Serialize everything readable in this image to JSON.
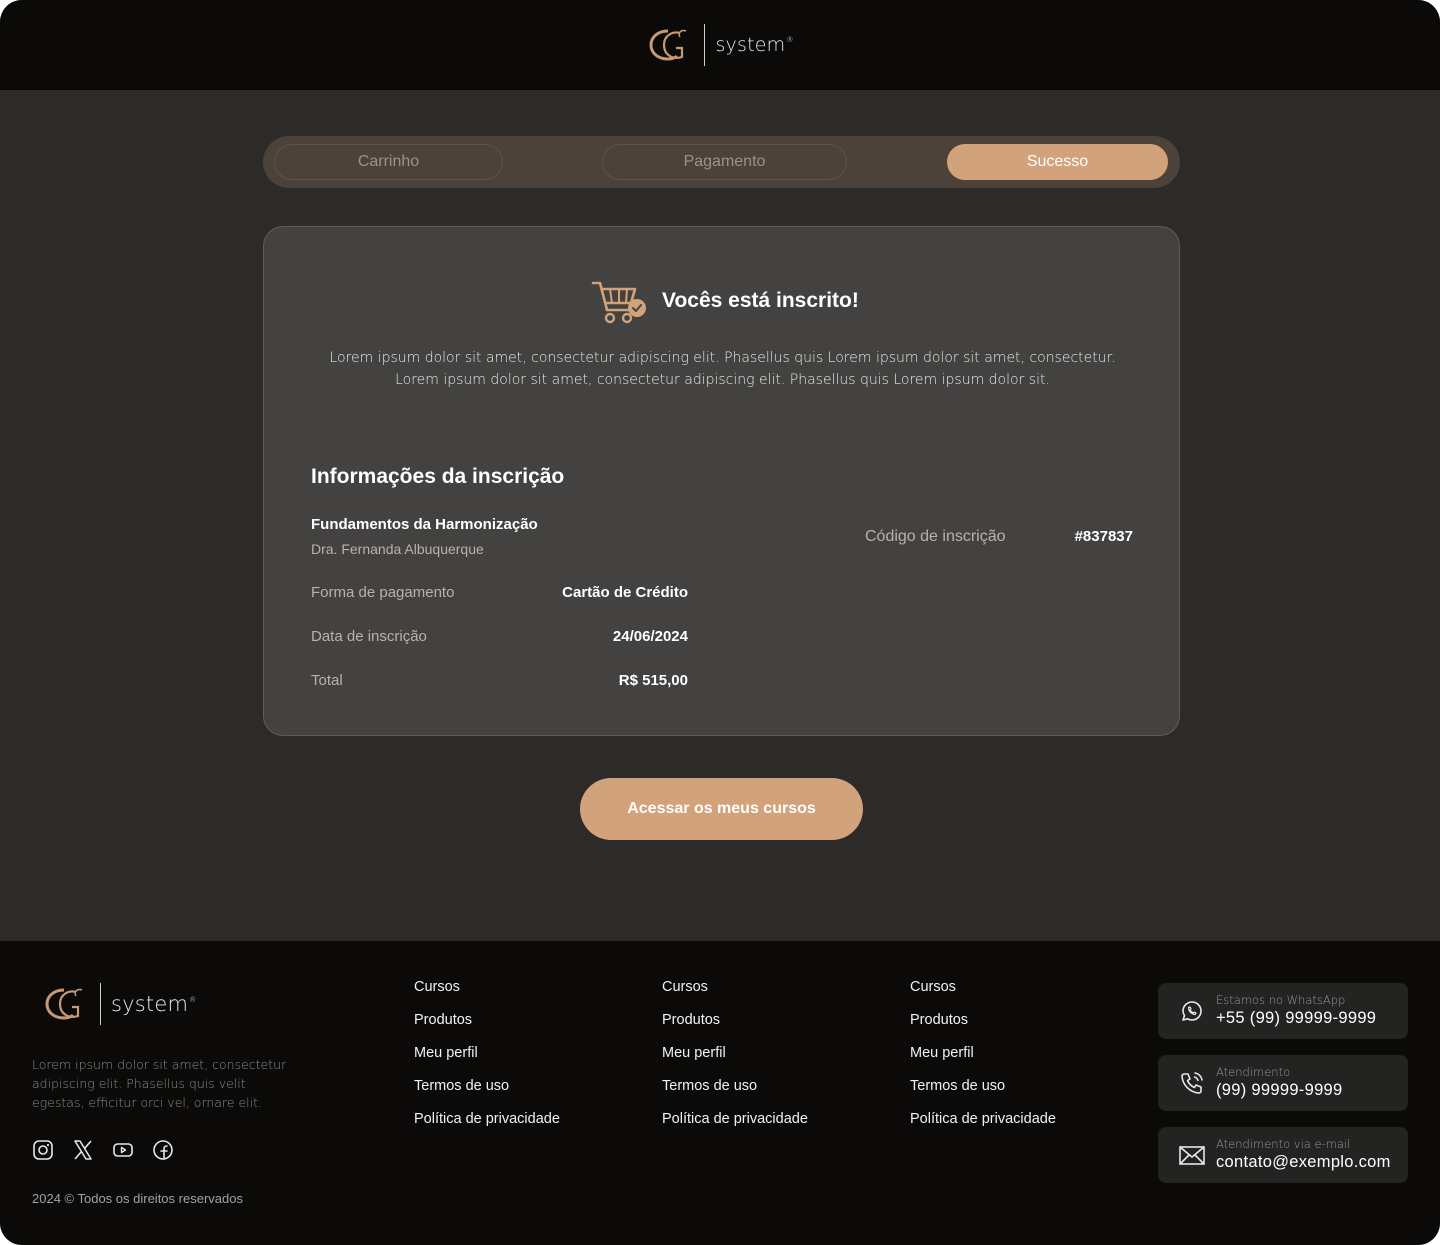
{
  "brand": {
    "name": "system",
    "reg": "®",
    "accent": "#d2a27a"
  },
  "stepper": {
    "steps": [
      {
        "label": "Carrinho",
        "state": "done"
      },
      {
        "label": "Pagamento",
        "state": "done"
      },
      {
        "label": "Sucesso",
        "state": "active"
      }
    ]
  },
  "success": {
    "icon": "cart-check-icon",
    "title": "Vocês está inscrito!",
    "description_line1": "Lorem ipsum dolor sit amet, consectetur adipiscing elit. Phasellus quis Lorem ipsum dolor sit amet, consectetur.",
    "description_line2": "Lorem ipsum dolor sit amet, consectetur adipiscing elit. Phasellus quis Lorem ipsum dolor sit."
  },
  "info": {
    "title": "Informações da inscrição",
    "course_name": "Fundamentos da Harmonização",
    "course_author": "Dra. Fernanda Albuquerque",
    "payment_label": "Forma de pagamento",
    "payment_value": "Cartão de Crédito",
    "date_label": "Data de inscrição",
    "date_value": "24/06/2024",
    "total_label": "Total",
    "total_value": "R$ 515,00",
    "code_label": "Código de inscrição",
    "code_value": "#837837"
  },
  "cta": {
    "label": "Acessar os meus cursos"
  },
  "footer": {
    "description": "Lorem ipsum dolor sit amet, consectetur adipiscing elit. Phasellus quis velit egestas, efficitur orci vel, ornare elit.",
    "socials": [
      "instagram-icon",
      "x-icon",
      "youtube-icon",
      "facebook-icon"
    ],
    "copyright": "2024 © Todos os direitos reservados",
    "columns": [
      {
        "links": [
          "Cursos",
          "Produtos",
          "Meu perfil",
          "Termos de uso",
          "Política de privacidade"
        ]
      },
      {
        "links": [
          "Cursos",
          "Produtos",
          "Meu perfil",
          "Termos de uso",
          "Política de privacidade"
        ]
      },
      {
        "links": [
          "Cursos",
          "Produtos",
          "Meu perfil",
          "Termos de uso",
          "Política de privacidade"
        ]
      }
    ],
    "contacts": [
      {
        "icon": "whatsapp-icon",
        "label": "Estamos no WhatsApp",
        "value": "+55 (99) 99999-9999"
      },
      {
        "icon": "phone-icon",
        "label": "Atendimento",
        "value": "(99) 99999-9999"
      },
      {
        "icon": "mail-icon",
        "label": "Atendimento via e-mail",
        "value": "contato@exemplo.com"
      }
    ]
  }
}
